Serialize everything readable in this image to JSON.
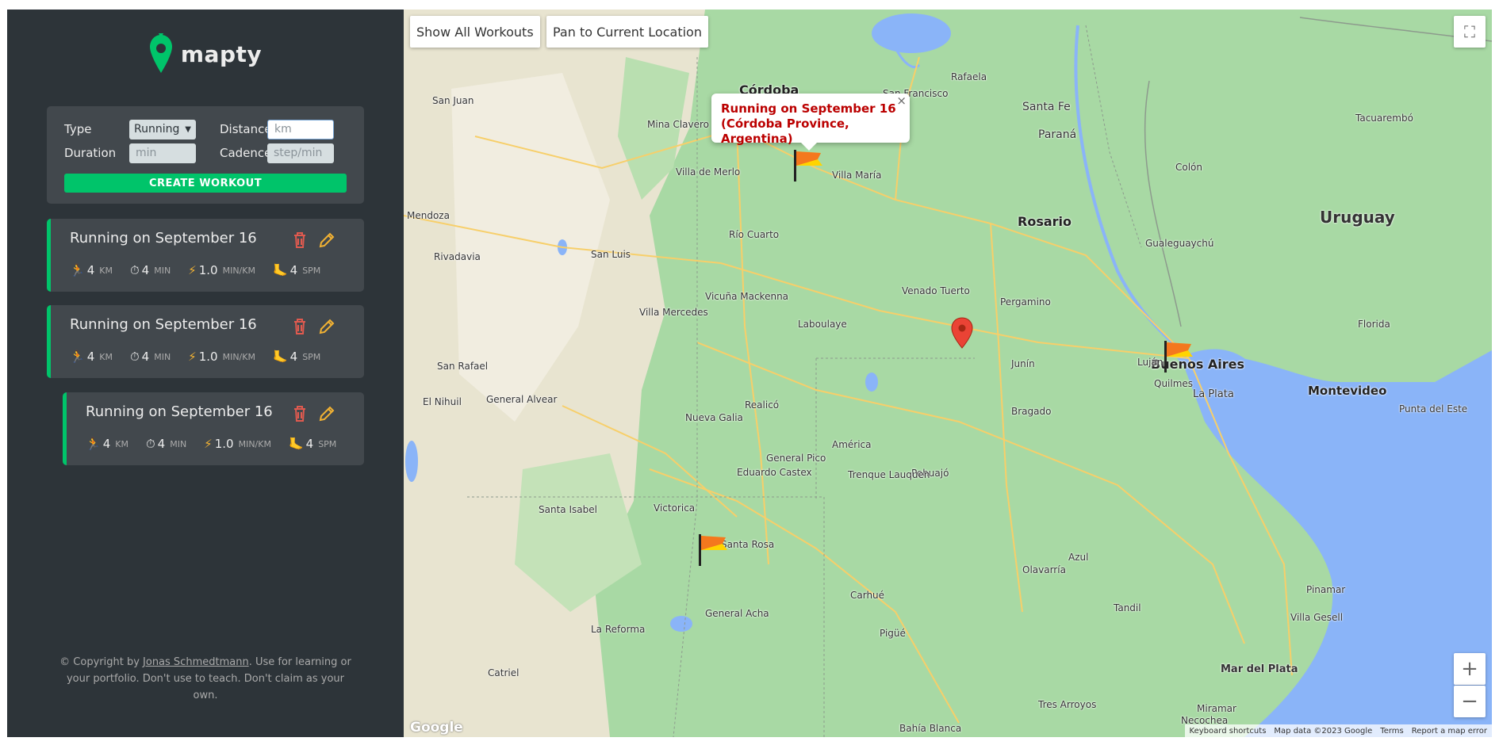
{
  "brand": {
    "name": "mapty"
  },
  "form": {
    "type_label": "Type",
    "type_value": "Running",
    "distance_label": "Distance",
    "distance_placeholder": "km",
    "duration_label": "Duration",
    "duration_placeholder": "min",
    "cadence_label": "Cadence",
    "cadence_placeholder": "step/min",
    "submit_label": "CREATE WORKOUT"
  },
  "workouts": [
    {
      "title": "Running on September 16",
      "distance": "4",
      "distance_unit": "KM",
      "duration": "4",
      "duration_unit": "MIN",
      "pace": "1.0",
      "pace_unit": "MIN/KM",
      "cadence": "4",
      "cadence_unit": "SPM"
    },
    {
      "title": "Running on September 16",
      "distance": "4",
      "distance_unit": "KM",
      "duration": "4",
      "duration_unit": "MIN",
      "pace": "1.0",
      "pace_unit": "MIN/KM",
      "cadence": "4",
      "cadence_unit": "SPM"
    },
    {
      "title": "Running on September 16",
      "distance": "4",
      "distance_unit": "KM",
      "duration": "4",
      "duration_unit": "MIN",
      "pace": "1.0",
      "pace_unit": "MIN/KM",
      "cadence": "4",
      "cadence_unit": "SPM"
    }
  ],
  "copyright": {
    "prefix": "© Copyright by ",
    "author": "Jonas Schmedtmann",
    "suffix": ". Use for learning or your portfolio. Don't use to teach. Don't claim as your own."
  },
  "map": {
    "show_all_label": "Show All Workouts",
    "pan_label": "Pan to Current Location",
    "popup_line1": "Running on September 16",
    "popup_line2": "(Córdoba Province, Argentina)",
    "popup_close": "×",
    "zoom_in": "+",
    "zoom_out": "−",
    "google": "Google",
    "footer": [
      "Keyboard shortcuts",
      "Map data ©2023 Google",
      "Terms",
      "Report a map error"
    ],
    "places": {
      "cordoba": "Córdoba",
      "rosario": "Rosario",
      "buenos_aires": "Buenos Aires",
      "uruguay": "Uruguay",
      "montevideo": "Montevideo",
      "la_plata": "La Plata",
      "santa_fe": "Santa Fe",
      "parana": "Paraná",
      "mendoza": "Mendoza",
      "san_juan": "San Juan",
      "san_luis": "San Luis",
      "rio_cuarto": "Río Cuarto",
      "villa_maria": "Villa María",
      "santa_rosa": "Santa Rosa",
      "san_rafael": "San Rafael",
      "junin": "Junín",
      "pergamino": "Pergamino",
      "laboulaye": "Laboulaye",
      "villa_mercedes": "Villa Mercedes",
      "general_pico": "General Pico",
      "victorica": "Victorica",
      "santa_isabel": "Santa Isabel",
      "general_acha": "General Acha",
      "la_reforma": "La Reforma",
      "azul": "Azul",
      "tandil": "Tandil",
      "olavarria": "Olavarría",
      "bahia_blanca": "Bahía Blanca",
      "carhue": "Carhué",
      "pigue": "Pigüé",
      "tres_arroyos": "Tres Arroyos",
      "necochea": "Necochea",
      "mar_del_plata": "Mar del Plata",
      "miramar": "Miramar",
      "punta_del_este": "Punta del Este",
      "pinamar": "Pinamar",
      "villa_gesell": "Villa Gesell",
      "rafaela": "Rafaela",
      "san_francisco": "San Francisco",
      "quilmes": "Quilmes",
      "lujan": "Luján",
      "bragado": "Bragado",
      "mina_clavero": "Mina Clavero",
      "villa_de_merlo": "Villa de Merlo",
      "tacuarembo": "Tacuarembó",
      "florida": "Florida",
      "colon": "Colón",
      "gualeguaychu": "Gualeguaychú",
      "venado_tuerto": "Venado Tuerto",
      "pehuajo": "Pehuajó",
      "trenque_lauquen": "Trenque Lauquen",
      "general_alvear": "General Alvear",
      "nueva_galia": "Nueva Galia",
      "realico": "Realicó",
      "america": "América",
      "eduardo_castex": "Eduardo Castex",
      "catriel": "Catriel",
      "vicuna_mackenna": "Vicuña Mackenna",
      "rivadavia": "Rivadavia",
      "el_nihuil": "El Nihuil"
    }
  }
}
